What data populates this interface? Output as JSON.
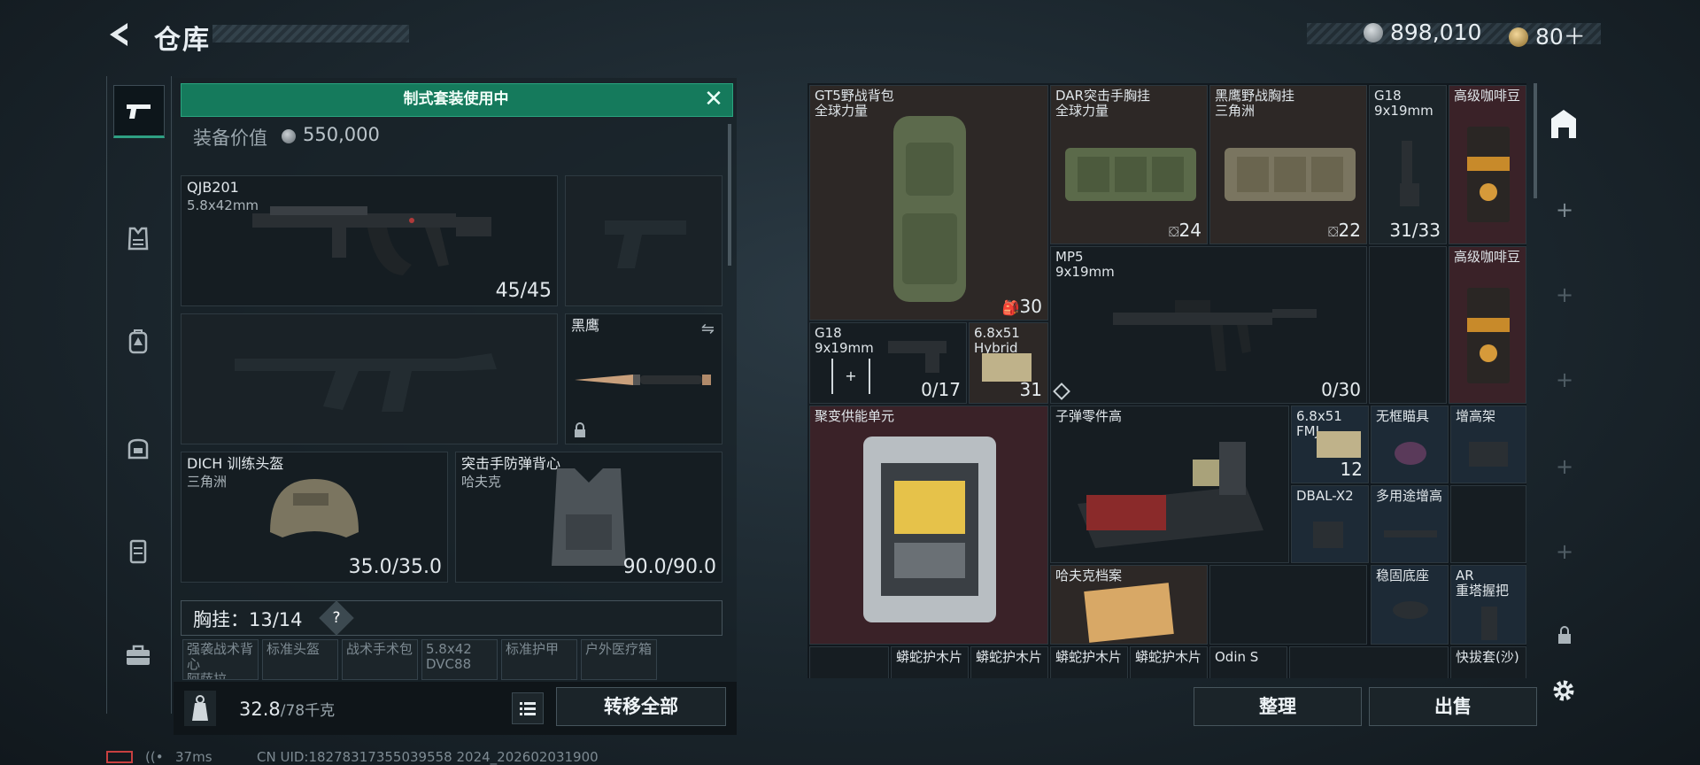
{
  "header": {
    "title": "仓库",
    "currency_1": "898,010",
    "currency_2": "80＋"
  },
  "loadout": {
    "banner": "制式套装使用中",
    "value_label": "装备价值",
    "value": "550,000",
    "primary_weapon": {
      "name": "QJB201",
      "caliber": "5.8x42mm",
      "ammo": "45/45"
    },
    "melee": {
      "name": "黑鹰"
    },
    "helmet": {
      "name": "DICH 训练头盔",
      "maker": "三角洲",
      "durability": "35.0/35.0"
    },
    "armor": {
      "name": "突击手防弹背心",
      "maker": "哈夫克",
      "durability": "90.0/90.0"
    },
    "chest_rig": "胸挂：13/14",
    "help": "?",
    "chest_items": [
      "强袭战术背心\n阿萨拉",
      "标准头盔",
      "战术手术包",
      "5.8x42\nDVC88",
      "标准护甲",
      "户外医疗箱"
    ],
    "weight": "32.8",
    "weight_max": "/78千克",
    "transfer_all": "转移全部"
  },
  "storage": {
    "items": [
      {
        "id": "gt5",
        "name": "GT5野战背包",
        "sub": "全球力量",
        "count": "30"
      },
      {
        "id": "dar",
        "name": "DAR突击手胸挂",
        "sub": "全球力量",
        "count": "24"
      },
      {
        "id": "heiying-rig",
        "name": "黑鹰野战胸挂",
        "sub": "三角洲",
        "count": "22"
      },
      {
        "id": "g18-a",
        "name": "G18",
        "sub": "9x19mm",
        "count": "31/33"
      },
      {
        "id": "coffee-1",
        "name": "高级咖啡豆",
        "sub": "",
        "count": ""
      },
      {
        "id": "mp5",
        "name": "MP5",
        "sub": "9x19mm",
        "count": "0/30"
      },
      {
        "id": "coffee-2",
        "name": "高级咖啡豆",
        "sub": "",
        "count": ""
      },
      {
        "id": "g18-b",
        "name": "G18",
        "sub": "9x19mm",
        "count": "0/17"
      },
      {
        "id": "ammo-hybrid",
        "name": "6.8x51",
        "sub": "Hybrid",
        "count": "31"
      },
      {
        "id": "fusion",
        "name": "聚变供能单元",
        "sub": "",
        "count": ""
      },
      {
        "id": "bullet-parts",
        "name": "子弹零件高",
        "sub": "",
        "count": ""
      },
      {
        "id": "ammo-fmj",
        "name": "6.8x51",
        "sub": "FMJ",
        "count": "12"
      },
      {
        "id": "frameless",
        "name": "无框瞄具",
        "sub": "",
        "count": ""
      },
      {
        "id": "riser",
        "name": "增高架",
        "sub": "",
        "count": ""
      },
      {
        "id": "dbal",
        "name": "DBAL-X2",
        "sub": "",
        "count": ""
      },
      {
        "id": "multi-riser",
        "name": "多用途增高",
        "sub": "",
        "count": ""
      },
      {
        "id": "haavk-file",
        "name": "哈夫克档案",
        "sub": "",
        "count": ""
      },
      {
        "id": "stable-base",
        "name": "稳固底座",
        "sub": "",
        "count": ""
      },
      {
        "id": "ar-grip",
        "name": "AR",
        "sub": "重塔握把",
        "count": ""
      },
      {
        "id": "plate-1",
        "name": "蟒蛇护木片",
        "sub": "",
        "count": ""
      },
      {
        "id": "plate-2",
        "name": "蟒蛇护木片",
        "sub": "",
        "count": ""
      },
      {
        "id": "plate-3",
        "name": "蟒蛇护木片",
        "sub": "",
        "count": ""
      },
      {
        "id": "plate-4",
        "name": "蟒蛇护木片",
        "sub": "",
        "count": ""
      },
      {
        "id": "odin",
        "name": "Odin S",
        "sub": "",
        "count": ""
      },
      {
        "id": "holster",
        "name": "快拔套(沙)",
        "sub": "",
        "count": ""
      }
    ],
    "sort": "整理",
    "sell": "出售"
  },
  "status": {
    "ping": "37ms",
    "uid": "CN UID:18278317355039558 2024_202602031900"
  },
  "colors": {
    "accent": "#157a5c",
    "highlight": "#2ea083",
    "red_cell": "#3a2228",
    "blue_cell": "#1d2a36"
  },
  "icons": [
    "back-arrow-icon",
    "silver-coin-icon",
    "gold-coin-icon",
    "pistol-icon",
    "armor-icon",
    "backpack-icon",
    "bag-icon",
    "case-icon",
    "toolbox-icon",
    "close-icon",
    "weight-icon",
    "list-icon",
    "storage-tab-icon",
    "lock-icon",
    "gear-icon"
  ]
}
